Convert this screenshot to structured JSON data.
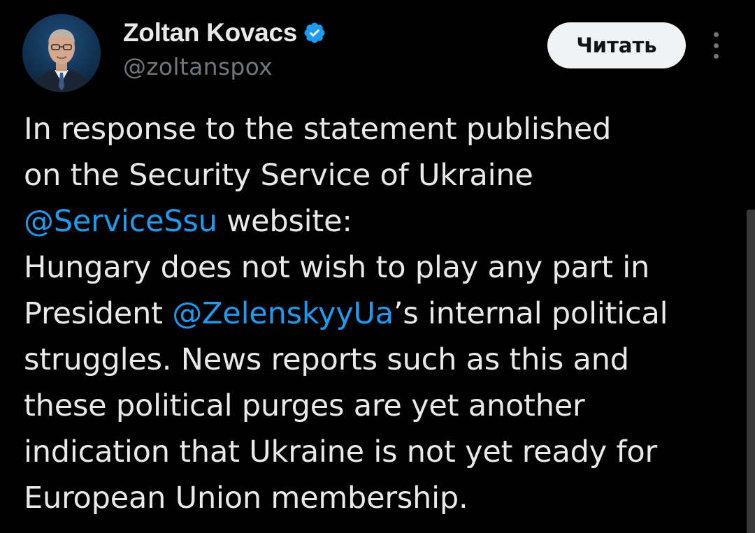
{
  "author": {
    "display_name": "Zoltan Kovacs",
    "handle": "@zoltanspox",
    "verified": true
  },
  "actions": {
    "follow_label": "Читать"
  },
  "tweet": {
    "lines": [
      [
        {
          "text": "In response to the statement published"
        }
      ],
      [
        {
          "text": "on the Security Service of Ukraine"
        }
      ],
      [
        {
          "text": "@ServiceSsu",
          "mention": true
        },
        {
          "text": " website:"
        }
      ],
      [
        {
          "text": "Hungary does not wish to play any part in"
        }
      ],
      [
        {
          "text": "President "
        },
        {
          "text": "@ZelenskyyUa",
          "mention": true
        },
        {
          "text": "’s internal political"
        }
      ],
      [
        {
          "text": "struggles. News reports such as this and"
        }
      ],
      [
        {
          "text": "these political purges are yet another"
        }
      ],
      [
        {
          "text": "indication that Ukraine is not yet ready for"
        }
      ],
      [
        {
          "text": "European Union membership."
        }
      ]
    ]
  },
  "colors": {
    "background": "#000000",
    "text": "#e7e9ea",
    "secondary": "#71767b",
    "link": "#1d9bf0",
    "verified_badge": "#1d9bf0"
  },
  "icons": {
    "verified": "verified-badge-icon",
    "more": "more-options-icon"
  }
}
